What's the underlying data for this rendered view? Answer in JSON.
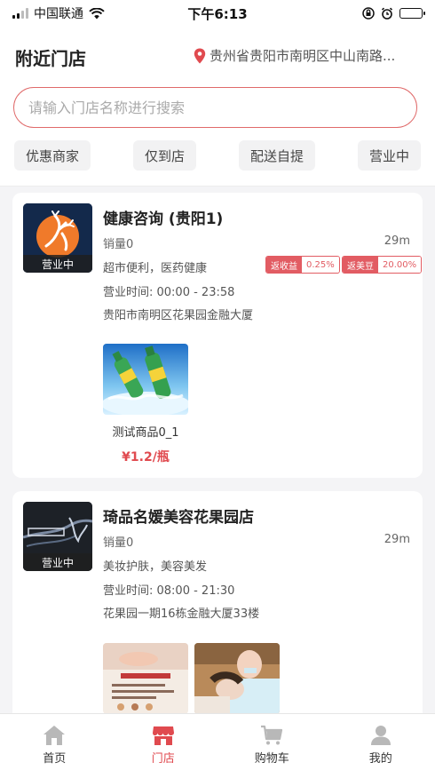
{
  "status_bar": {
    "carrier": "中国联通",
    "time": "下午6:13"
  },
  "header": {
    "title": "附近门店",
    "location": "贵州省贵阳市南明区中山南路..."
  },
  "search": {
    "placeholder": "请输入门店名称进行搜索"
  },
  "filters": [
    "优惠商家",
    "仅到店",
    "配送自提",
    "营业中"
  ],
  "stores": [
    {
      "name": "健康咨询 (贵阳1)",
      "status": "营业中",
      "sales": "销量0",
      "distance": "29m",
      "category": "超市便利，医药健康",
      "tags": [
        {
          "label": "返收益",
          "value": "0.25%"
        },
        {
          "label": "返美豆",
          "value": "20.00%"
        }
      ],
      "hours": "营业时间: 00:00 - 23:58",
      "address": "贵阳市南明区花果园金融大厦",
      "products": [
        {
          "name": "测试商品0_1",
          "price": "¥1.2/瓶"
        }
      ]
    },
    {
      "name": "琦品名媛美容花果园店",
      "status": "营业中",
      "sales": "销量0",
      "distance": "29m",
      "category": "美妆护肤，美容美发",
      "hours": "营业时间: 08:00 - 21:30",
      "address": "花果园一期16栋金融大厦33楼"
    }
  ],
  "tabbar": {
    "items": [
      "首页",
      "门店",
      "购物车",
      "我的"
    ],
    "active": "门店"
  },
  "colors": {
    "accent": "#e04a4f",
    "tab_inactive_icon": "#b8b8b8"
  }
}
